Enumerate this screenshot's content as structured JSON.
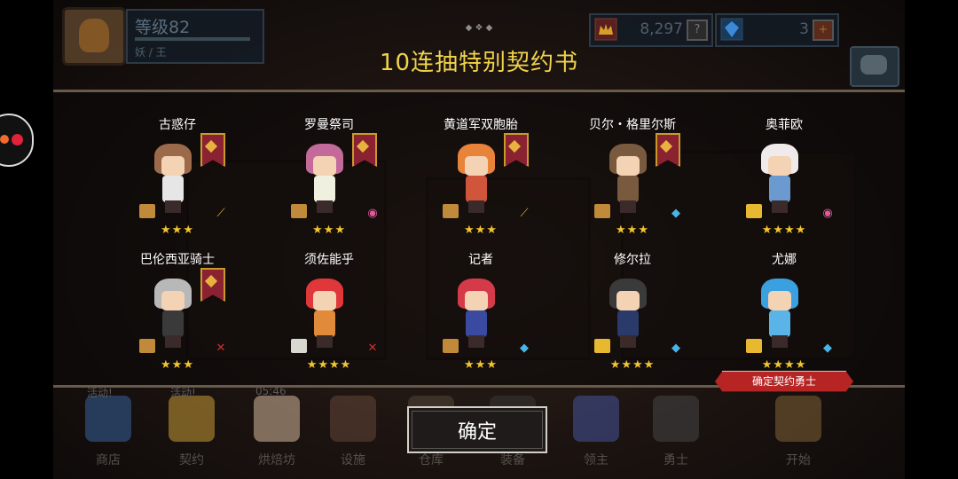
{
  "hud": {
    "level": "等级82",
    "player_title": "妖 / 王",
    "gold": "8,297",
    "gold_btn": "?",
    "gems": "3",
    "gems_btn": "+"
  },
  "title": "10连抽特别契约书",
  "heroes": [
    {
      "name": "古惑仔",
      "stars": "★★★",
      "banner": true,
      "elem": "sword",
      "scroll": "bronze",
      "hair": "#9b6a4a",
      "body": "#e6e6e6"
    },
    {
      "name": "罗曼祭司",
      "stars": "★★★",
      "banner": true,
      "elem": "fire-orb",
      "scroll": "bronze",
      "hair": "#c46a9a",
      "body": "#f0f0e0"
    },
    {
      "name": "黄道军双胞胎",
      "stars": "★★★",
      "banner": true,
      "elem": "sword",
      "scroll": "bronze",
      "hair": "#e8833a",
      "body": "#d0553a"
    },
    {
      "name": "贝尔・格里尔斯",
      "stars": "★★★",
      "banner": true,
      "elem": "water",
      "scroll": "bronze",
      "hair": "#7a5a3e",
      "body": "#7a5a3e"
    },
    {
      "name": "奥菲欧",
      "stars": "★★★★",
      "banner": false,
      "elem": "fire-orb",
      "scroll": "gold",
      "hair": "#f0eaea",
      "body": "#6a9ad0"
    },
    {
      "name": "巴伦西亚骑士",
      "stars": "★★★",
      "banner": true,
      "elem": "cross-sword",
      "scroll": "bronze",
      "hair": "#b8b8b8",
      "body": "#3a3a3a"
    },
    {
      "name": "须佐能乎",
      "stars": "★★★★",
      "banner": false,
      "elem": "cross-sword",
      "scroll": "silver",
      "hair": "#e0383a",
      "body": "#e08a3a"
    },
    {
      "name": "记者",
      "stars": "★★★",
      "banner": false,
      "elem": "water",
      "scroll": "bronze",
      "hair": "#d43a4a",
      "body": "#3a4aa0"
    },
    {
      "name": "修尔拉",
      "stars": "★★★★",
      "banner": false,
      "elem": "water",
      "scroll": "gold",
      "hair": "#3a3a3a",
      "body": "#2a3a6a"
    },
    {
      "name": "尤娜",
      "stars": "★★★★",
      "banner": false,
      "elem": "water",
      "scroll": "gold",
      "hair": "#3aa0e0",
      "body": "#5ab4e8"
    }
  ],
  "select_ribbon": "确定契约勇士",
  "confirm_label": "确定",
  "nav": [
    {
      "label": "商店",
      "tag": "活动!"
    },
    {
      "label": "契约",
      "tag": "活动!"
    },
    {
      "label": "烘焙坊",
      "tag": "05:46"
    },
    {
      "label": "设施",
      "tag": ""
    },
    {
      "label": "仓库",
      "tag": ""
    },
    {
      "label": "装备",
      "tag": ""
    },
    {
      "label": "领主",
      "tag": ""
    },
    {
      "label": "勇士",
      "tag": ""
    },
    {
      "label": "开始",
      "tag": ""
    }
  ],
  "colors": {
    "title": "#f1d34a",
    "stars": "#f2c530",
    "ribbon": "#b62424"
  }
}
